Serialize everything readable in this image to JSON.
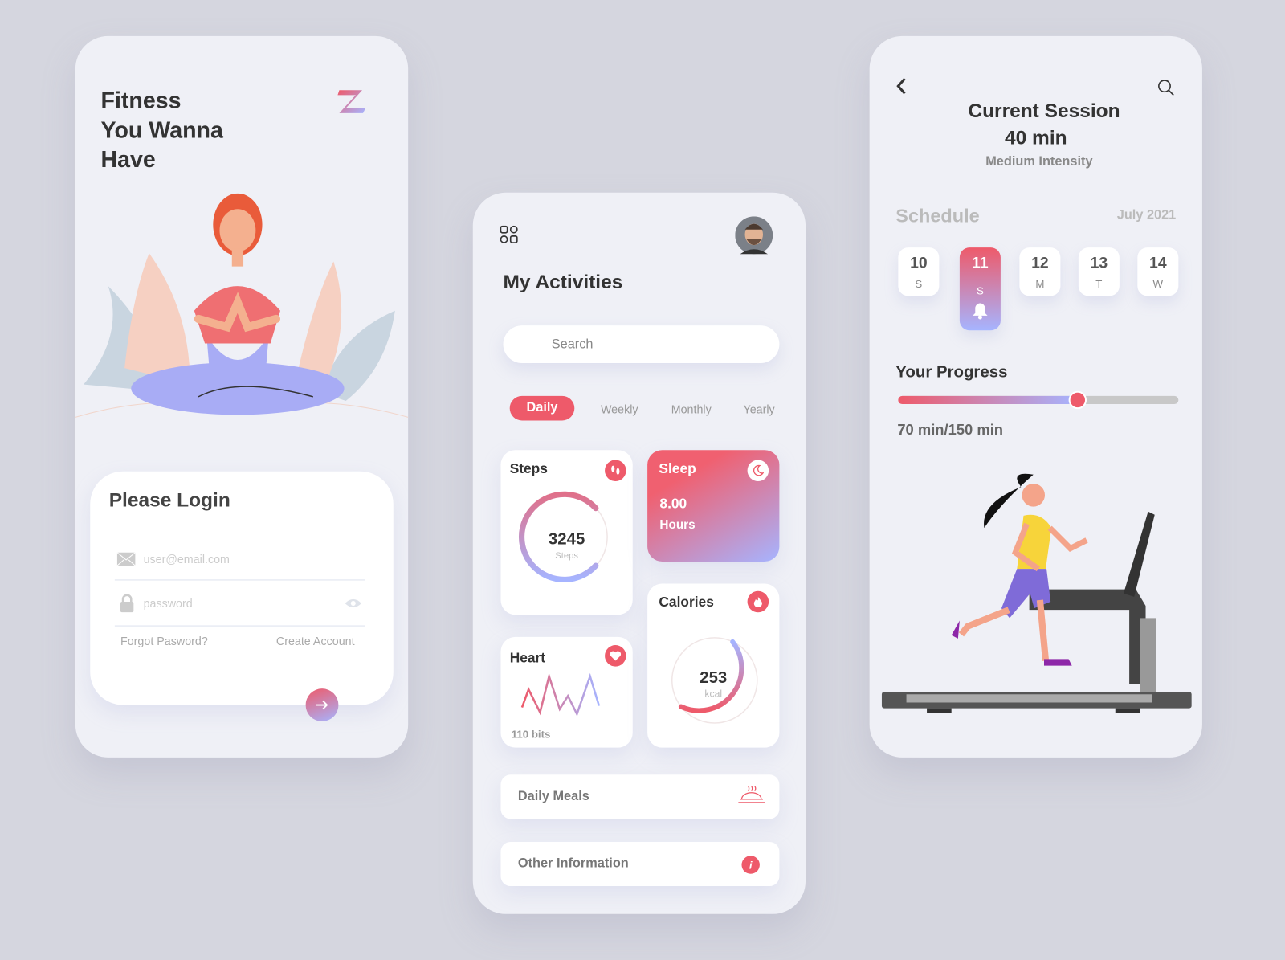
{
  "login_screen": {
    "title_lines": [
      "Fitness",
      "You Wanna",
      "Have"
    ],
    "logo_letter": "Z",
    "card_title": "Please Login",
    "email_placeholder": "user@email.com",
    "password_placeholder": "password",
    "forgot_label": "Forgot Pasword?",
    "create_label": "Create Account"
  },
  "activities_screen": {
    "title": "My Activities",
    "search_placeholder": "Search",
    "tabs": [
      {
        "label": "Daily",
        "active": true
      },
      {
        "label": "Weekly"
      },
      {
        "label": "Monthly"
      },
      {
        "label": "Yearly"
      }
    ],
    "steps": {
      "title": "Steps",
      "value": "3245",
      "unit": "Steps"
    },
    "sleep": {
      "title": "Sleep",
      "value": "8.00",
      "unit": "Hours"
    },
    "heart": {
      "title": "Heart",
      "value": "110 bits"
    },
    "calories": {
      "title": "Calories",
      "value": "253",
      "unit": "kcal"
    },
    "daily_meals": "Daily Meals",
    "other_info": "Other Information"
  },
  "session_screen": {
    "title": "Current Session",
    "duration": "40 min",
    "intensity": "Medium Intensity",
    "schedule_label": "Schedule",
    "month": "July 2021",
    "days": [
      {
        "num": "10",
        "wd": "S"
      },
      {
        "num": "11",
        "wd": "S",
        "active": true
      },
      {
        "num": "12",
        "wd": "M"
      },
      {
        "num": "13",
        "wd": "T"
      },
      {
        "num": "14",
        "wd": "W"
      }
    ],
    "progress_label": "Your Progress",
    "progress_text": "70 min/150 min",
    "progress_fill": 0.64
  },
  "colors": {
    "accent": "#ee5a6a",
    "accent2": "#a6b4ff",
    "background": "#d5d6df",
    "panel": "#eff0f6"
  }
}
